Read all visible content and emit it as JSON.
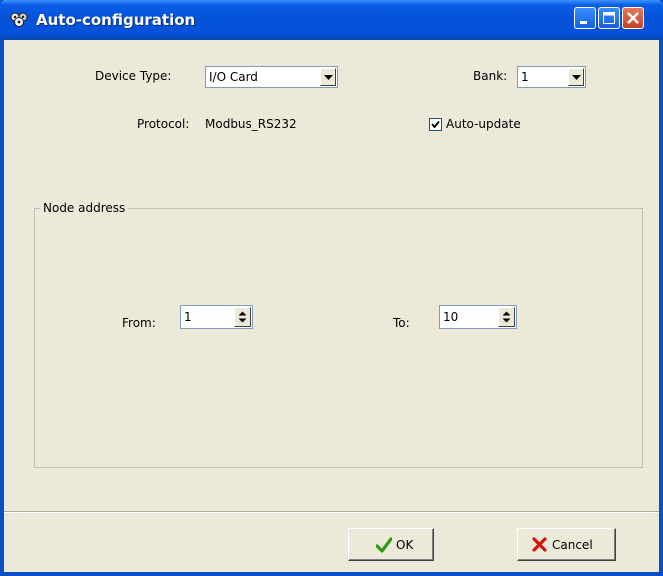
{
  "window": {
    "title": "Auto-configuration"
  },
  "device": {
    "label": "Device Type:",
    "value": "I/O Card"
  },
  "bank": {
    "label": "Bank:",
    "value": "1"
  },
  "protocol": {
    "label": "Protocol:",
    "value": "Modbus_RS232"
  },
  "auto_update": {
    "label": "Auto-update",
    "checked": true
  },
  "node_address": {
    "legend": "Node address",
    "from": {
      "label": "From:",
      "value": "1"
    },
    "to": {
      "label": "To:",
      "value": "10"
    }
  },
  "buttons": {
    "ok": "OK",
    "cancel": "Cancel"
  },
  "colors": {
    "title_bar": "#0553d8",
    "window_bg": "#ece9d8",
    "ok_check": "#2e9a12",
    "cancel_x": "#d1140e"
  },
  "icons": [
    "app-icon",
    "minimize-icon",
    "maximize-icon",
    "close-icon",
    "dropdown-arrow-icon",
    "checkmark-icon",
    "spin-arrows-icon",
    "ok-check-icon",
    "cancel-x-icon"
  ]
}
